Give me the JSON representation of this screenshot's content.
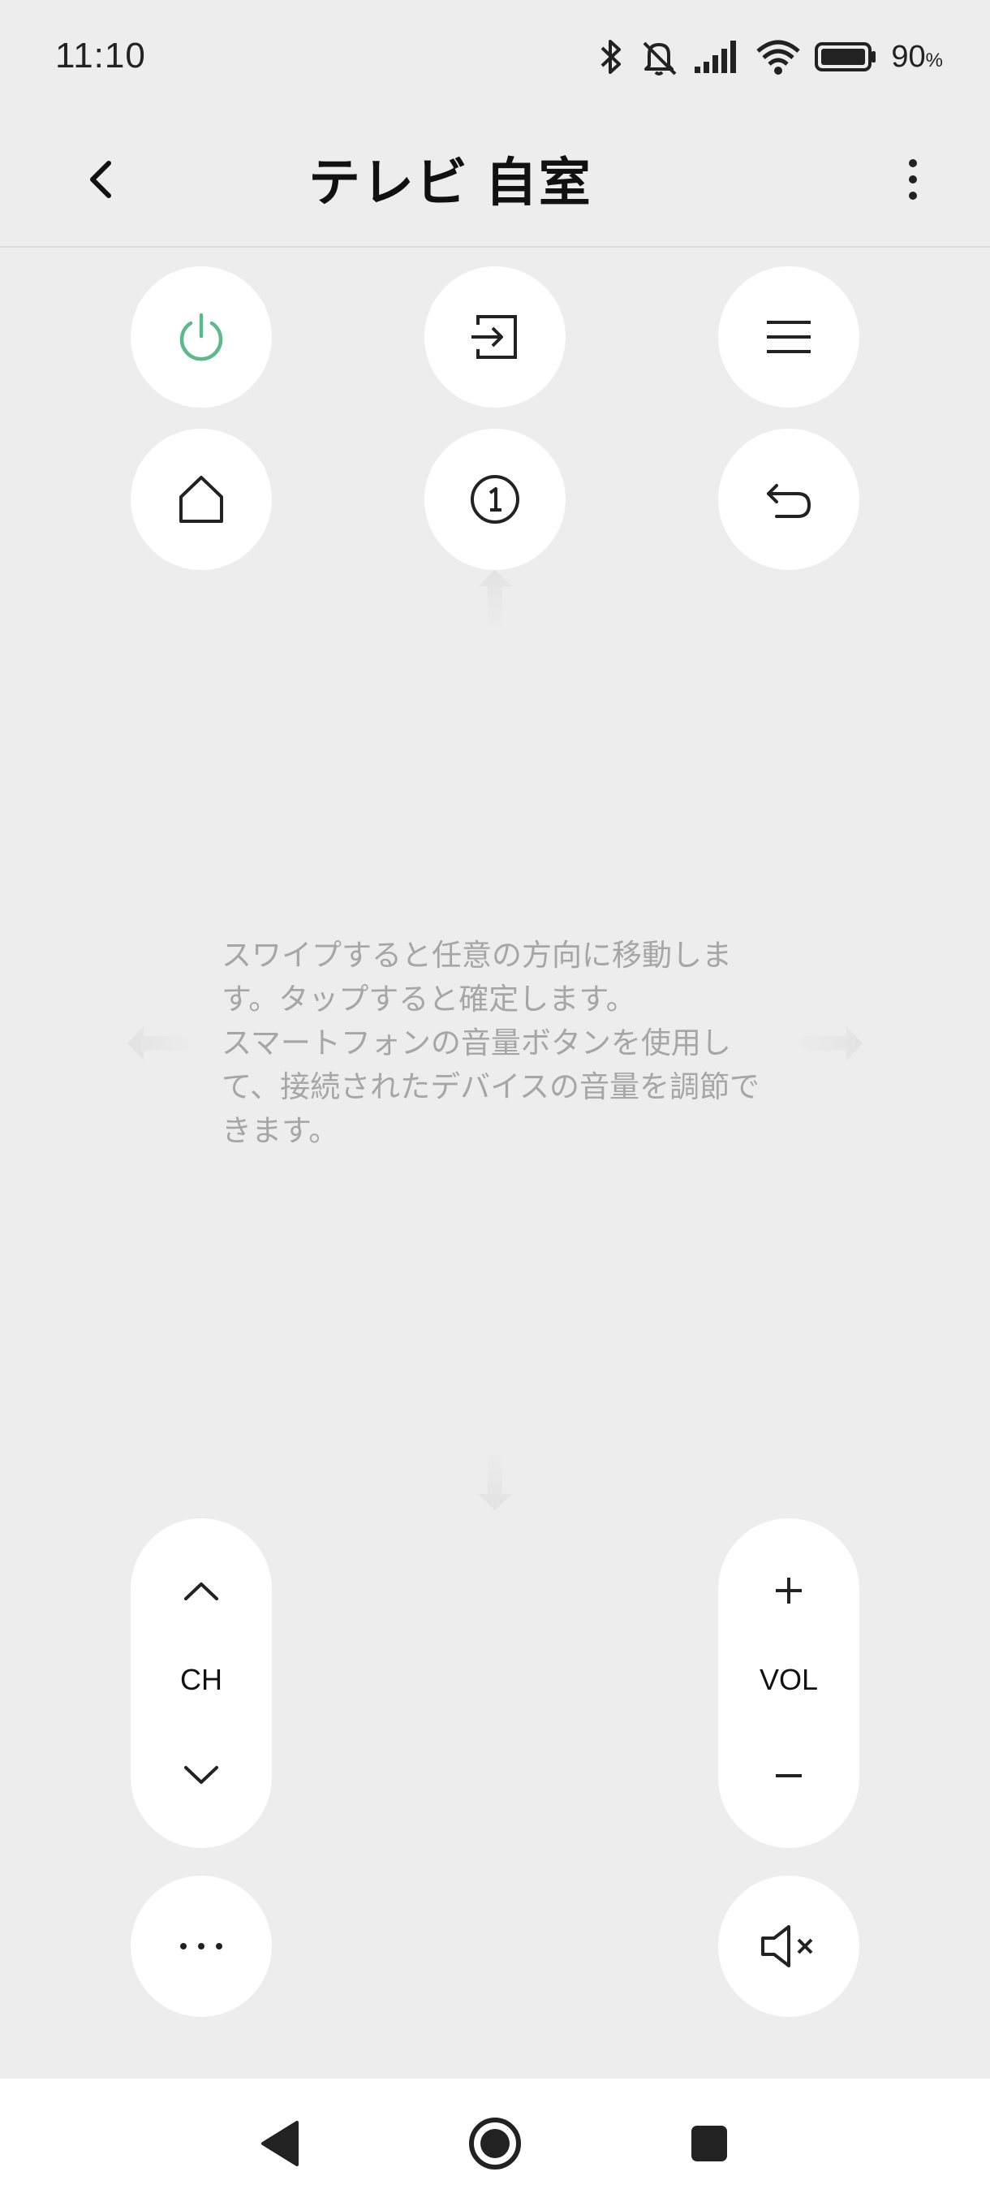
{
  "status_bar": {
    "time": "11:10",
    "battery_percent": "90",
    "battery_unit": "%",
    "icons": [
      "bluetooth-icon",
      "silent-icon",
      "signal-icon",
      "wifi-icon",
      "battery-icon"
    ]
  },
  "header": {
    "title": "テレビ 自室",
    "back_icon": "chevron-left-icon",
    "more_icon": "more-vertical-icon"
  },
  "remote": {
    "buttons": [
      {
        "name": "power",
        "icon": "power-icon"
      },
      {
        "name": "input",
        "icon": "input-source-icon"
      },
      {
        "name": "menu",
        "icon": "menu-icon"
      },
      {
        "name": "home",
        "icon": "home-icon"
      },
      {
        "name": "number",
        "icon": "number-one-icon"
      },
      {
        "name": "back",
        "icon": "return-icon"
      }
    ],
    "hint_text": "スワイプすると任意の方向に移動しま\nす。タップすると確定します。\nスマートフォンの音量ボタンを使用し\nて、接続されたデバイスの音量を調節で\nきます。",
    "channel_label": "CH",
    "volume_label": "VOL",
    "more_icon": "more-horizontal-icon",
    "mute_icon": "mute-icon"
  },
  "colors": {
    "power_accent": "#5cb98a",
    "background": "#ededed",
    "button_bg": "#ffffff",
    "hint_text": "#a6a6a6"
  },
  "nav_bar": {
    "icons": [
      "nav-back-icon",
      "nav-home-icon",
      "nav-recents-icon"
    ]
  }
}
